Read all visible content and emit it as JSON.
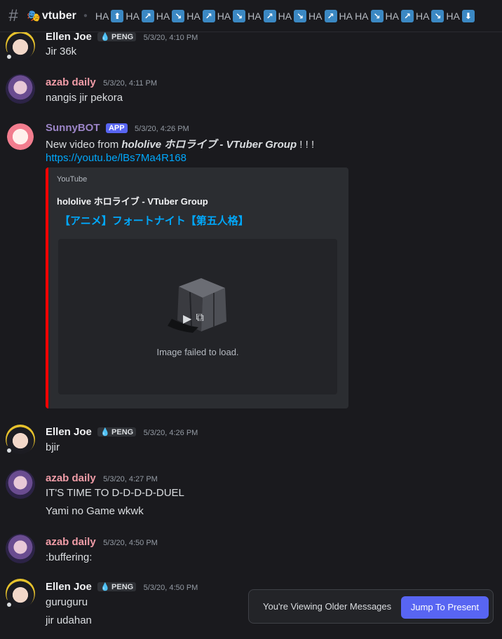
{
  "channel": {
    "name": "vtuber",
    "topic_segments": [
      "HA",
      "⬆",
      "HA",
      "↗",
      "HA",
      "↘",
      "HA",
      "↗",
      "HA",
      "↘",
      "HA",
      "↗",
      "HA",
      "↘",
      "HA",
      "↗",
      "HA HA",
      "↘",
      "HA",
      "↗",
      "HA",
      "↘",
      "HA",
      "⬇"
    ]
  },
  "messages": [
    {
      "author": "Ellen Joe",
      "tag": "PENG",
      "time": "5/3/20, 4:10 PM",
      "lines": [
        "Jir 36k"
      ]
    },
    {
      "author": "azab daily",
      "time": "5/3/20, 4:11 PM",
      "lines": [
        "nangis jir pekora"
      ]
    },
    {
      "author": "SunnyBOT",
      "badge": "APP",
      "time": "5/3/20, 4:26 PM",
      "text_prefix": "New video from ",
      "text_bold": "hololive ホロライブ - VTuber Group",
      "text_suffix": " ! ! !",
      "link": "https://youtu.be/lBs7Ma4R168"
    },
    {
      "author": "Ellen Joe",
      "tag": "PENG",
      "time": "5/3/20, 4:26 PM",
      "lines": [
        "bjir"
      ]
    },
    {
      "author": "azab daily",
      "time": "5/3/20, 4:27 PM",
      "lines": [
        "IT'S TIME TO D-D-D-D-DUEL",
        "Yami no Game wkwk"
      ]
    },
    {
      "author": "azab daily",
      "time": "5/3/20, 4:50 PM",
      "lines": [
        ":buffering:"
      ]
    },
    {
      "author": "Ellen Joe",
      "tag": "PENG",
      "time": "5/3/20, 4:50 PM",
      "lines": [
        "guruguru",
        "jir udahan"
      ]
    }
  ],
  "embed": {
    "provider": "YouTube",
    "author": "hololive ホロライブ - VTuber Group",
    "title": "【アニメ】フォートナイト【第五人格】",
    "image_error": "Image failed to load."
  },
  "toast": {
    "text": "You're Viewing Older Messages",
    "button": "Jump To Present"
  },
  "colors": {
    "accent": "#5865f2",
    "link": "#00a8fc",
    "azab_name": "#f09ca7",
    "embed_border": "#ff0000"
  }
}
